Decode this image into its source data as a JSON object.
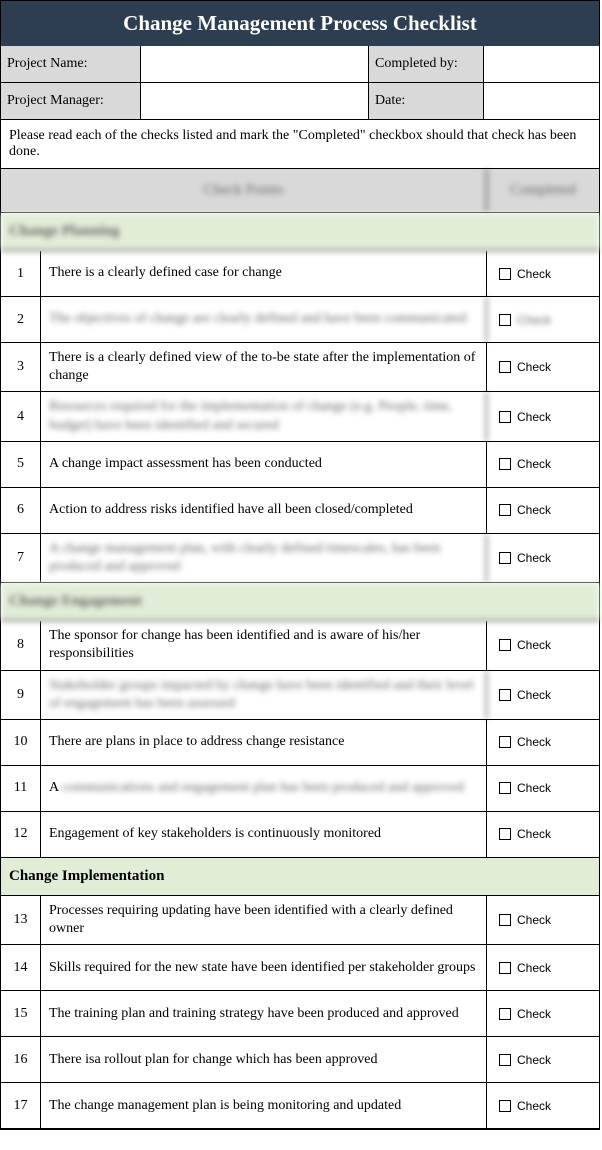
{
  "title": "Change Management Process Checklist",
  "info": {
    "project_name_label": "Project Name:",
    "completed_by_label": "Completed by:",
    "project_manager_label": "Project Manager:",
    "date_label": "Date:"
  },
  "instructions": "Please read each of the checks listed and mark the \"Completed\" checkbox should that check has been done.",
  "column_header_left": "Check Points",
  "column_header_right": "Completed",
  "check_label": "Check",
  "sections": [
    {
      "title": "Change Planning",
      "title_blurred": true,
      "items": [
        {
          "num": 1,
          "text": "There is a clearly defined case for change",
          "blurred": false
        },
        {
          "num": 2,
          "text": "The objectives of change are clearly defined and have been communicated",
          "blurred": true
        },
        {
          "num": 3,
          "text": "There is a clearly defined view of the to-be state after the implementation of change",
          "blurred": false
        },
        {
          "num": 4,
          "text": "Resources required for the implementation of change (e.g. People, time, budget) have been identified and secured",
          "blurred": true
        },
        {
          "num": 5,
          "text": "A change impact assessment has been conducted",
          "blurred": false
        },
        {
          "num": 6,
          "text": "Action to address risks identified have all been closed/completed",
          "blurred": false
        },
        {
          "num": 7,
          "text": "A change management plan, with clearly defined timescales, has been produced and approved",
          "blurred": true
        }
      ]
    },
    {
      "title": "Change Engagement",
      "title_blurred": true,
      "items": [
        {
          "num": 8,
          "text": "The sponsor for change has been identified and is aware of his/her responsibilities",
          "blurred": false
        },
        {
          "num": 9,
          "text": "Stakeholder groups impacted by change have been identified and their level of engagement has been assessed",
          "blurred": true
        },
        {
          "num": 10,
          "text": "There are plans in place to address change resistance",
          "blurred": false
        },
        {
          "num": 11,
          "text": "A communications and engagement plan has been produced and approved",
          "blurred": "partial"
        },
        {
          "num": 12,
          "text": "Engagement of key stakeholders is continuously monitored",
          "blurred": false
        }
      ]
    },
    {
      "title": "Change Implementation",
      "title_blurred": false,
      "items": [
        {
          "num": 13,
          "text": "Processes requiring updating have been identified with a clearly defined owner",
          "blurred": false
        },
        {
          "num": 14,
          "text": "Skills required for the new state have been identified per stakeholder groups",
          "blurred": false
        },
        {
          "num": 15,
          "text": "The training plan and training strategy have been produced and approved",
          "blurred": false
        },
        {
          "num": 16,
          "text": "There isa rollout plan for change which has been approved",
          "blurred": false
        },
        {
          "num": 17,
          "text": "The change management plan is being monitoring and updated",
          "blurred": false
        }
      ]
    }
  ]
}
